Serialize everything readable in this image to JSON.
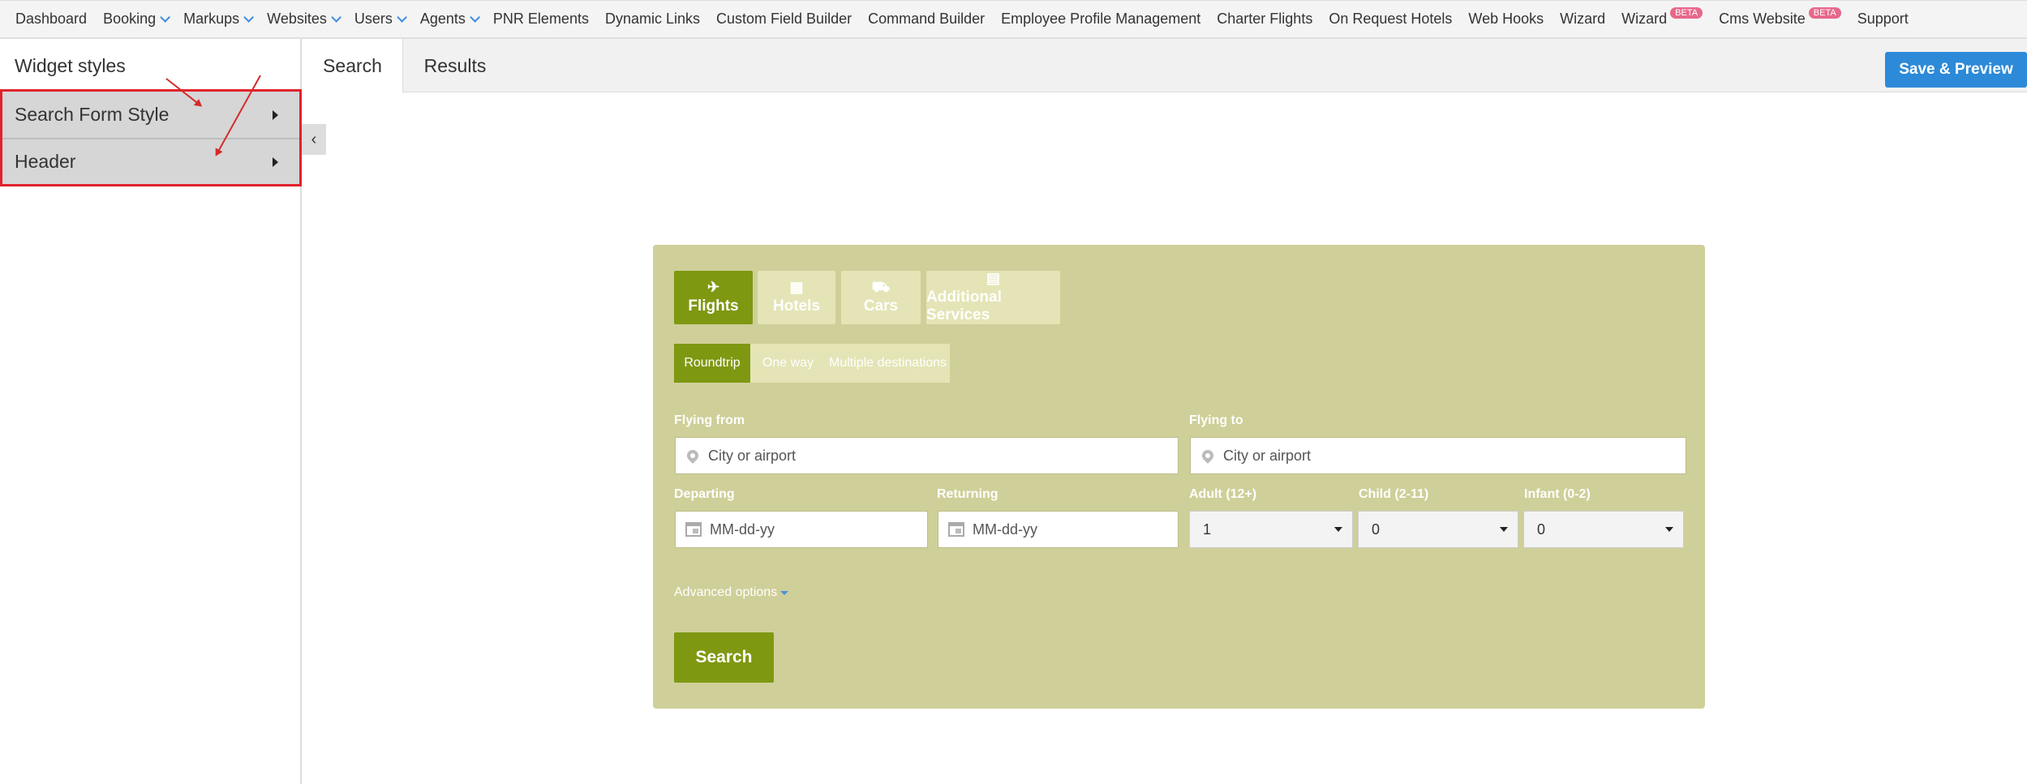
{
  "topnav": {
    "items": [
      {
        "label": "Dashboard",
        "dropdown": false
      },
      {
        "label": "Booking",
        "dropdown": true
      },
      {
        "label": "Markups",
        "dropdown": true
      },
      {
        "label": "Websites",
        "dropdown": true
      },
      {
        "label": "Users",
        "dropdown": true
      },
      {
        "label": "Agents",
        "dropdown": true
      },
      {
        "label": "PNR Elements",
        "dropdown": false
      },
      {
        "label": "Dynamic Links",
        "dropdown": false
      },
      {
        "label": "Custom Field Builder",
        "dropdown": false
      },
      {
        "label": "Command Builder",
        "dropdown": false
      },
      {
        "label": "Employee Profile Management",
        "dropdown": false
      },
      {
        "label": "Charter Flights",
        "dropdown": false
      },
      {
        "label": "On Request Hotels",
        "dropdown": false
      },
      {
        "label": "Web Hooks",
        "dropdown": false
      },
      {
        "label": "Wizard",
        "dropdown": false
      },
      {
        "label": "Wizard",
        "badge": "BETA"
      },
      {
        "label": "Cms Website",
        "badge": "BETA"
      },
      {
        "label": "Support",
        "dropdown": false
      }
    ]
  },
  "sidebar": {
    "title": "Widget styles",
    "items": [
      "Search Form Style",
      "Header"
    ],
    "collapse_icon": "‹"
  },
  "tabs": [
    "Search",
    "Results"
  ],
  "save_button": "Save & Preview",
  "widget": {
    "product_tabs": [
      {
        "label": "Flights",
        "icon": "✈"
      },
      {
        "label": "Hotels",
        "icon": "▦"
      },
      {
        "label": "Cars",
        "icon": "⛟"
      },
      {
        "label": "Additional Services",
        "icon": "▤"
      }
    ],
    "trip_types": [
      "Roundtrip",
      "One way",
      "Multiple destinations"
    ],
    "flying_from_label": "Flying from",
    "flying_from_placeholder": "City or airport",
    "flying_to_label": "Flying to",
    "flying_to_placeholder": "City or airport",
    "departing_label": "Departing",
    "departing_placeholder": "MM-dd-yy",
    "returning_label": "Returning",
    "returning_placeholder": "MM-dd-yy",
    "adult_label": "Adult (12+)",
    "adult_value": "1",
    "child_label": "Child (2-11)",
    "child_value": "0",
    "infant_label": "Infant (0-2)",
    "infant_value": "0",
    "advanced_options": "Advanced options",
    "search_button": "Search",
    "colors": {
      "background": "#cfcf99",
      "active": "#7f9812",
      "inactive": "#e4e4b6"
    }
  }
}
